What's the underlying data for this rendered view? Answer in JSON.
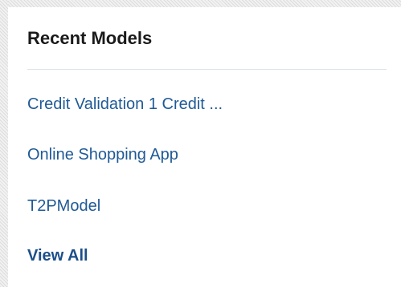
{
  "panel": {
    "title": "Recent Models",
    "models": [
      "Credit Validation 1 Credit ...",
      "Online Shopping App",
      "T2PModel"
    ],
    "view_all_label": "View All"
  },
  "colors": {
    "link": "#1f5a96",
    "title": "#1a1a1a",
    "divider": "#d9e4ee"
  }
}
